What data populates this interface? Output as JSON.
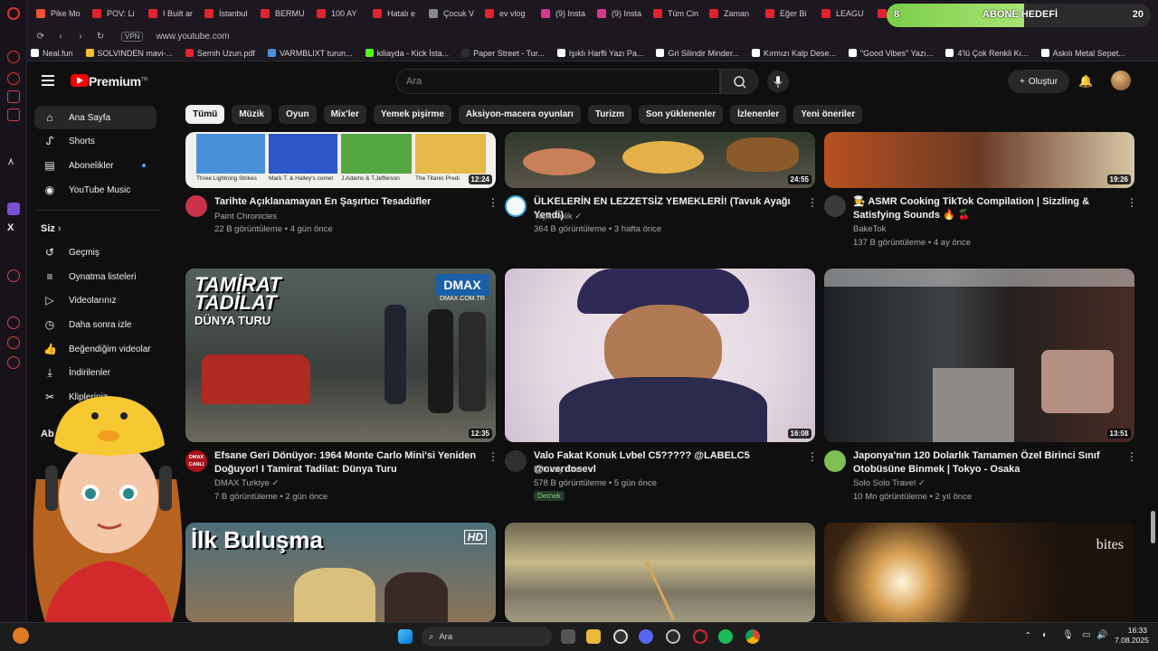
{
  "browser": {
    "tabs": [
      "Pike Mo",
      "POV: Li",
      "I Built ar",
      "İstanbul",
      "BERMU",
      "100 AY",
      "Hatalı e",
      "Çocuk V",
      "ev vlog",
      "(9) Insta",
      "(9) Insta",
      "Tüm Cin",
      "Zaman",
      "Eğer Bi",
      "LEAGU",
      "T"
    ],
    "address": "www.youtube.com",
    "vpn_label": "VPN",
    "bookmarks": [
      "Neal.fun",
      "SOLVINDEN mavi-...",
      "Semih Uzun.pdf",
      "VARMBLIXT turun...",
      "kiliayda - Kick İsta...",
      "Paper Street - Tur...",
      "Işıklı Harfli Yazı Pa...",
      "Gri Silindir Minder...",
      "Kırmızı Kalp Dese...",
      "\"Good Vibes\" Yazı...",
      "4'lü Çok Renkli Kı...",
      "Askılı Metal Sepet..."
    ]
  },
  "abone_widget": {
    "current": "8",
    "label": "ABONE HEDEFİ",
    "target": "20",
    "progress": 0.52
  },
  "header": {
    "brand": "Premium",
    "brand_sup": "TR",
    "search_placeholder": "Ara",
    "create_label": "Oluştur"
  },
  "chips": [
    "Tümü",
    "Müzik",
    "Oyun",
    "Mix'ler",
    "Yemek pişirme",
    "Aksiyon-macera oyunları",
    "Turizm",
    "Son yüklenenler",
    "İzlenenler",
    "Yeni öneriler"
  ],
  "sidebar": {
    "main": [
      "Ana Sayfa",
      "Shorts",
      "Abonelikler",
      "YouTube Music"
    ],
    "you_heading": "Siz",
    "you_items": [
      "Geçmiş",
      "Oynatma listeleri",
      "Videolarınız",
      "Daha sonra izle",
      "Beğendiğim videolar",
      "İndirilenler",
      "Klipleriniz"
    ],
    "subs_heading": "Ab"
  },
  "videos": [
    {
      "title": "Tarihte Açıklanamayan En Şaşırtıcı Tesadüfler",
      "channel": "Paint Chronicles",
      "meta": "22 B görüntüleme • 4 gün önce",
      "duration": "12:24",
      "panels": [
        "Three Lightning Strikes",
        "Mark T. & Halley's comet",
        "J.Adams & T.Jefferson",
        "The Titanic Predi"
      ]
    },
    {
      "title": "ÜLKELERİN EN LEZZETSİZ YEMEKLERİ! (Tavuk Ayağı Yendi)",
      "channel": "TepkiKolik",
      "meta": "364 B görüntüleme • 3 hafta önce",
      "duration": "24:55"
    },
    {
      "title": "🧑‍🍳 ASMR Cooking TikTok Compilation | Sizzling & Satisfying Sounds 🔥 🍒",
      "channel": "BakeTok",
      "meta": "137 B görüntüleme • 4 ay önce",
      "duration": "19:26"
    },
    {
      "title": "Efsane Geri Dönüyor: 1964 Monte Carlo Mini'si Yeniden Doğuyor! I Tamirat Tadilat: Dünya Turu",
      "channel": "DMAX Turkiye",
      "meta": "7 B görüntüleme • 2 gün önce",
      "duration": "12:35",
      "thumb_text": [
        "TAMİRAT",
        "TADİLAT",
        "DÜNYA TURU",
        "DMAX",
        "DMAX.COM.TR"
      ],
      "avatar_text": [
        "DMAX",
        "CANLI"
      ]
    },
    {
      "title": "Valo Fakat Konuk Lvbel C5????? @LABELC5 @overdosevl",
      "channel": "Tolunay Ören",
      "meta": "578 B görüntüleme • 5 gün önce",
      "duration": "16:08",
      "badge": "Dernek"
    },
    {
      "title": "Japonya'nın 120 Dolarlık Tamamen Özel Birinci Sınıf Otobüsüne Binmek | Tokyo - Osaka",
      "channel": "Solo Solo Travel",
      "meta": "10 Mn görüntüleme • 2 yıl önce",
      "duration": "13:51"
    },
    {
      "thumb_text": "İlk Buluşma",
      "hd": "HD"
    },
    {},
    {
      "thumb_text": "bites"
    }
  ],
  "taskbar": {
    "search": "Ara",
    "time": "16:33",
    "date": "7.08.2025"
  }
}
